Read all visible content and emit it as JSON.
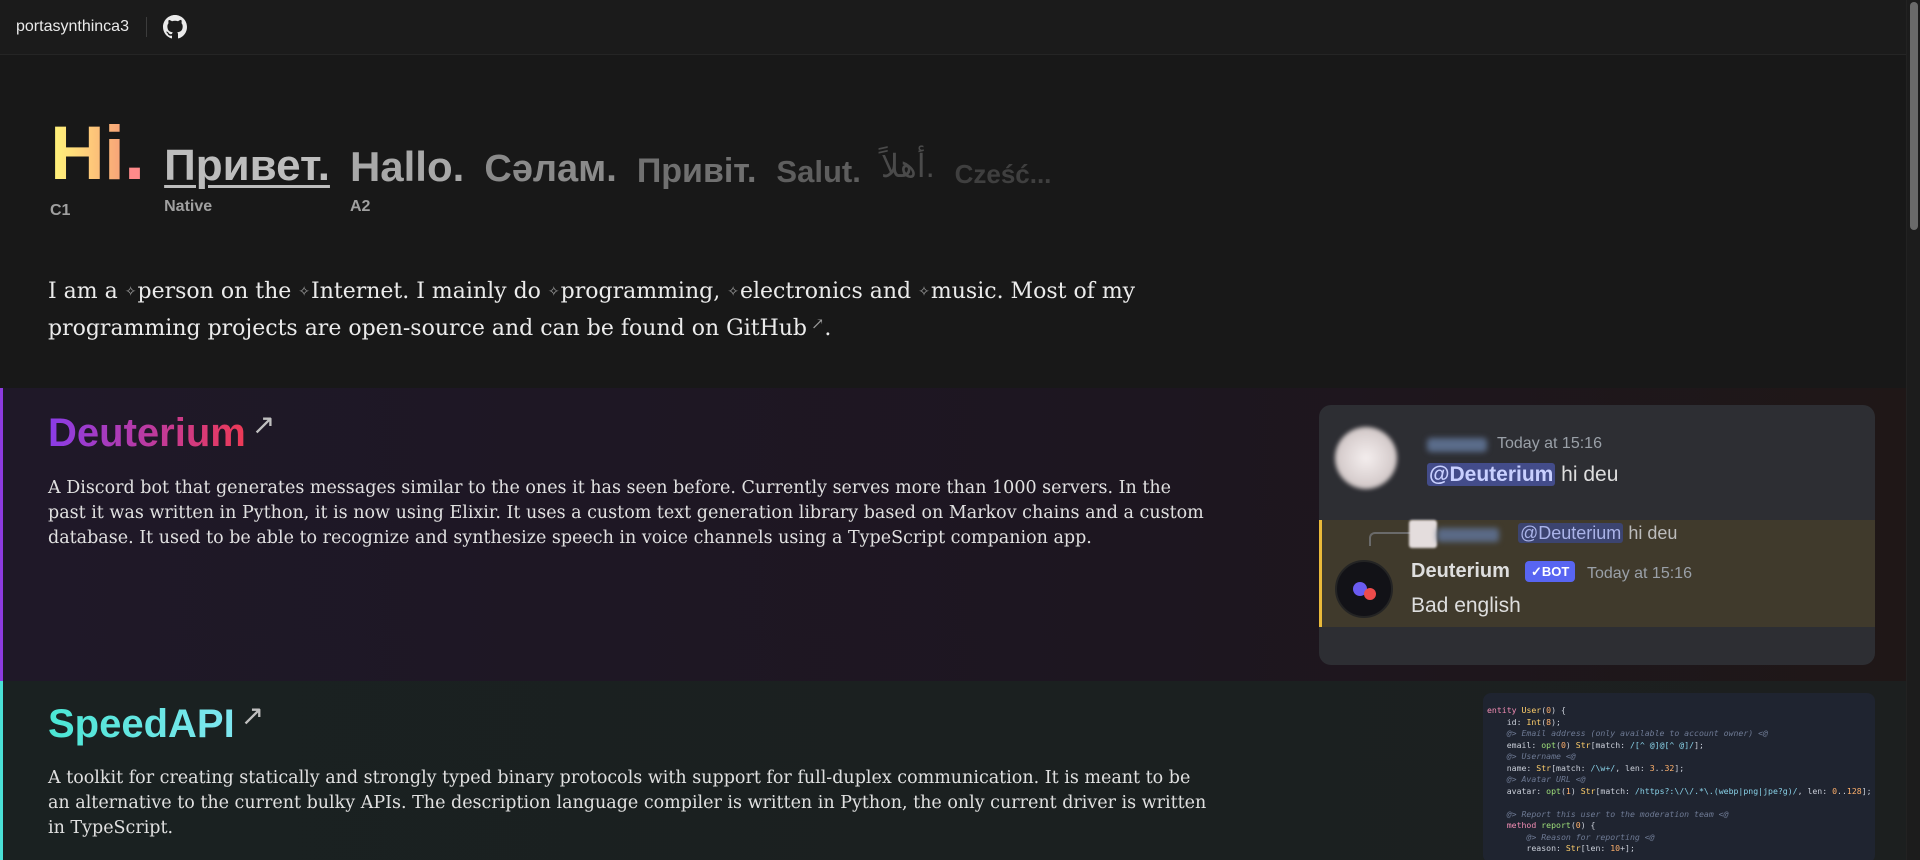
{
  "topbar": {
    "brand": "portasynthinca3",
    "github_icon": "github-icon"
  },
  "greetings": [
    {
      "word": "Hi",
      "punct": ".",
      "level": "C1"
    },
    {
      "word": "Привет.",
      "level": "Native"
    },
    {
      "word": "Hallo.",
      "level": "A2"
    },
    {
      "word": "Сәлам.",
      "level": ""
    },
    {
      "word": "Привіт.",
      "level": ""
    },
    {
      "word": "Salut.",
      "level": ""
    },
    {
      "word": "أهلاً.",
      "level": ""
    },
    {
      "word": "Cześć...",
      "level": ""
    }
  ],
  "intro": {
    "t1": "I am a ",
    "l1": "person",
    "t2": " on the ",
    "l2": "Internet",
    "t3": ". I mainly do ",
    "l3": "programming",
    "t4": ", ",
    "l4": "electronics",
    "t5": " and ",
    "l5": "music",
    "t6": ". Most of my programming projects are open-source and can be found on ",
    "l6": "GitHub",
    "t7": ".",
    "spark": "✧",
    "arrow": "↗"
  },
  "projects": {
    "deuterium": {
      "title": "Deuterium",
      "arrow": "↗",
      "description": "A Discord bot that generates messages similar to the ones it has seen before. Currently serves more than 1000 servers. In the past it was written in Python, it is now using Elixir. It uses a custom text generation library based on Markov chains and a custom database. It used to be able to recognize and synthesize speech in voice channels using a TypeScript companion app.",
      "chat": {
        "msg1_time": "Today at 15:16",
        "msg1_mention": "@Deuterium",
        "msg1_text": " hi deu",
        "reply_mention": "@Deuterium",
        "reply_text": " hi deu",
        "bot_name": "Deuterium",
        "bot_tag": "✓BOT",
        "bot_time": "Today at 15:16",
        "bot_text": "Bad english"
      }
    },
    "speedapi": {
      "title": "SpeedAPI",
      "arrow": "↗",
      "description": "A toolkit for creating statically and strongly typed binary protocols with support for full-duplex communication. It is meant to be an alternative to the current bulky APIs. The description language compiler is written in Python, the only current driver is written in TypeScript."
    }
  }
}
